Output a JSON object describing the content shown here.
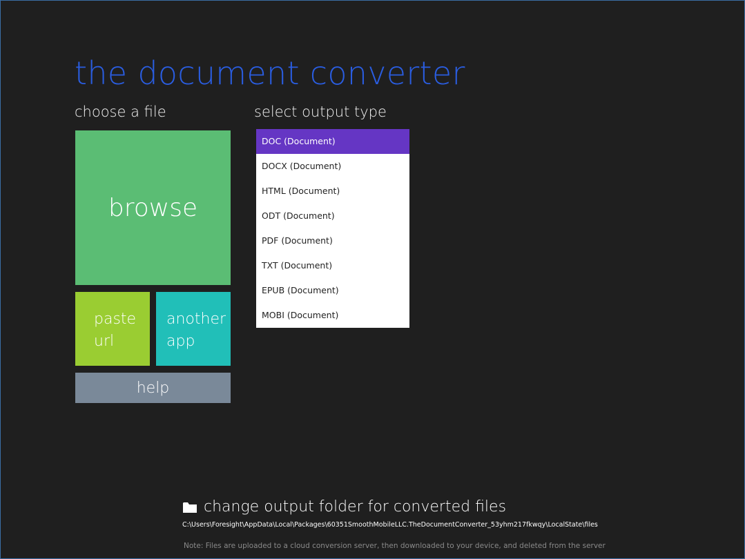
{
  "app": {
    "title": "the document converter"
  },
  "choose": {
    "label": "choose a file",
    "browse_label": "browse",
    "paste_line1": "paste",
    "paste_line2": "url",
    "another_line1": "another",
    "another_line2": "app",
    "help_label": "help"
  },
  "output": {
    "label": "select output type",
    "selected_index": 0,
    "options": [
      "DOC (Document)",
      "DOCX (Document)",
      "HTML (Document)",
      "ODT (Document)",
      "PDF (Document)",
      "TXT (Document)",
      "EPUB (Document)",
      "MOBI (Document)"
    ]
  },
  "footer": {
    "folder_label": "change output folder for converted files",
    "folder_path": "C:\\Users\\Foresight\\AppData\\Local\\Packages\\60351SmoothMobileLLC.TheDocumentConverter_53yhm217fkwqy\\LocalState\\files",
    "note": "Note: Files are uploaded to a cloud conversion server, then downloaded to your device, and deleted from the server"
  },
  "colors": {
    "background": "#1f1f1f",
    "title": "#2a5de0",
    "browse_tile": "#5bbd74",
    "paste_tile": "#9acd32",
    "another_tile": "#21bfb8",
    "help_tile": "#7a8999",
    "selected_item": "#6536c4"
  },
  "icons": {
    "folder": "folder-icon"
  }
}
